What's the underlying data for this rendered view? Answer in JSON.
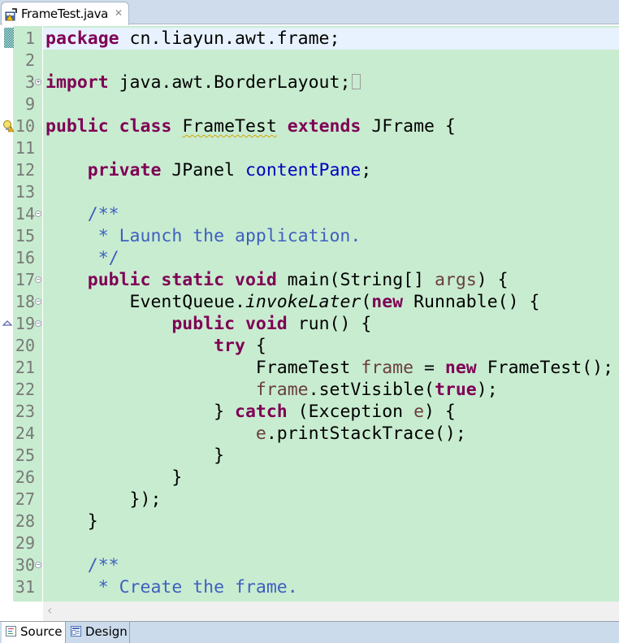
{
  "editor_tab": {
    "title": "FrameTest.java",
    "icon": "java-file-warning-icon",
    "close_icon": "close-icon"
  },
  "lines": [
    {
      "num": "1",
      "current": true,
      "tokens": [
        {
          "t": "package",
          "c": "kw"
        },
        {
          "t": " cn.liayun.awt.frame;"
        }
      ]
    },
    {
      "num": "2",
      "tokens": []
    },
    {
      "num": "3",
      "fold": "+",
      "tokens": [
        {
          "t": "import",
          "c": "kw"
        },
        {
          "t": " java.awt.BorderLayout;"
        }
      ],
      "collapsed": true
    },
    {
      "num": "9",
      "tokens": []
    },
    {
      "num": "10",
      "marker": "warning-lightbulb-icon",
      "tokens": [
        {
          "t": "public",
          "c": "kw"
        },
        {
          "t": " "
        },
        {
          "t": "class",
          "c": "kw"
        },
        {
          "t": " "
        },
        {
          "t": "FrameTest",
          "c": "warn"
        },
        {
          "t": " "
        },
        {
          "t": "extends",
          "c": "kw"
        },
        {
          "t": " JFrame {"
        }
      ]
    },
    {
      "num": "11",
      "tokens": []
    },
    {
      "num": "12",
      "tokens": [
        {
          "t": "    "
        },
        {
          "t": "private",
          "c": "kw"
        },
        {
          "t": " JPanel "
        },
        {
          "t": "contentPane",
          "c": "fld"
        },
        {
          "t": ";"
        }
      ]
    },
    {
      "num": "13",
      "tokens": []
    },
    {
      "num": "14",
      "fold": "-",
      "tokens": [
        {
          "t": "    "
        },
        {
          "t": "/**",
          "c": "cm"
        }
      ]
    },
    {
      "num": "15",
      "tokens": [
        {
          "t": "     * Launch the application.",
          "c": "cm"
        }
      ]
    },
    {
      "num": "16",
      "tokens": [
        {
          "t": "     */",
          "c": "cm"
        }
      ]
    },
    {
      "num": "17",
      "fold": "-",
      "tokens": [
        {
          "t": "    "
        },
        {
          "t": "public",
          "c": "kw"
        },
        {
          "t": " "
        },
        {
          "t": "static",
          "c": "kw"
        },
        {
          "t": " "
        },
        {
          "t": "void",
          "c": "kw"
        },
        {
          "t": " main(String[] "
        },
        {
          "t": "args",
          "c": "loc"
        },
        {
          "t": ") {"
        }
      ]
    },
    {
      "num": "18",
      "fold": "-",
      "tokens": [
        {
          "t": "        EventQueue."
        },
        {
          "t": "invokeLater",
          "c": "it"
        },
        {
          "t": "("
        },
        {
          "t": "new",
          "c": "kw"
        },
        {
          "t": " Runnable() {"
        }
      ]
    },
    {
      "num": "19",
      "fold": "-",
      "marker": "override-triangle-icon",
      "tokens": [
        {
          "t": "            "
        },
        {
          "t": "public",
          "c": "kw"
        },
        {
          "t": " "
        },
        {
          "t": "void",
          "c": "kw"
        },
        {
          "t": " run() {"
        }
      ]
    },
    {
      "num": "20",
      "tokens": [
        {
          "t": "                "
        },
        {
          "t": "try",
          "c": "kw"
        },
        {
          "t": " {"
        }
      ]
    },
    {
      "num": "21",
      "tokens": [
        {
          "t": "                    FrameTest "
        },
        {
          "t": "frame",
          "c": "loc"
        },
        {
          "t": " = "
        },
        {
          "t": "new",
          "c": "kw"
        },
        {
          "t": " FrameTest();"
        }
      ]
    },
    {
      "num": "22",
      "tokens": [
        {
          "t": "                    "
        },
        {
          "t": "frame",
          "c": "loc"
        },
        {
          "t": ".setVisible("
        },
        {
          "t": "true",
          "c": "kw"
        },
        {
          "t": ");"
        }
      ]
    },
    {
      "num": "23",
      "tokens": [
        {
          "t": "                } "
        },
        {
          "t": "catch",
          "c": "kw"
        },
        {
          "t": " (Exception "
        },
        {
          "t": "e",
          "c": "loc"
        },
        {
          "t": ") {"
        }
      ]
    },
    {
      "num": "24",
      "tokens": [
        {
          "t": "                    "
        },
        {
          "t": "e",
          "c": "loc"
        },
        {
          "t": ".printStackTrace();"
        }
      ]
    },
    {
      "num": "25",
      "tokens": [
        {
          "t": "                }"
        }
      ]
    },
    {
      "num": "26",
      "tokens": [
        {
          "t": "            }"
        }
      ]
    },
    {
      "num": "27",
      "tokens": [
        {
          "t": "        });"
        }
      ]
    },
    {
      "num": "28",
      "tokens": [
        {
          "t": "    }"
        }
      ]
    },
    {
      "num": "29",
      "tokens": []
    },
    {
      "num": "30",
      "fold": "-",
      "tokens": [
        {
          "t": "    "
        },
        {
          "t": "/**",
          "c": "cm"
        }
      ]
    },
    {
      "num": "31",
      "tokens": [
        {
          "t": "     * Create the frame.",
          "c": "cm"
        }
      ]
    }
  ],
  "scrollbar": {
    "left_arrow": "‹"
  },
  "bottom_tabs": [
    {
      "label": "Source",
      "icon": "source-icon",
      "active": true
    },
    {
      "label": "Design",
      "icon": "design-icon",
      "active": false
    }
  ],
  "colors": {
    "keyword": "#7f0055",
    "comment": "#3f5fbf",
    "field": "#0000c0",
    "local_variable": "#6a3e3e",
    "editor_background": "#c8ecd0",
    "current_line": "#e8f2fe"
  }
}
